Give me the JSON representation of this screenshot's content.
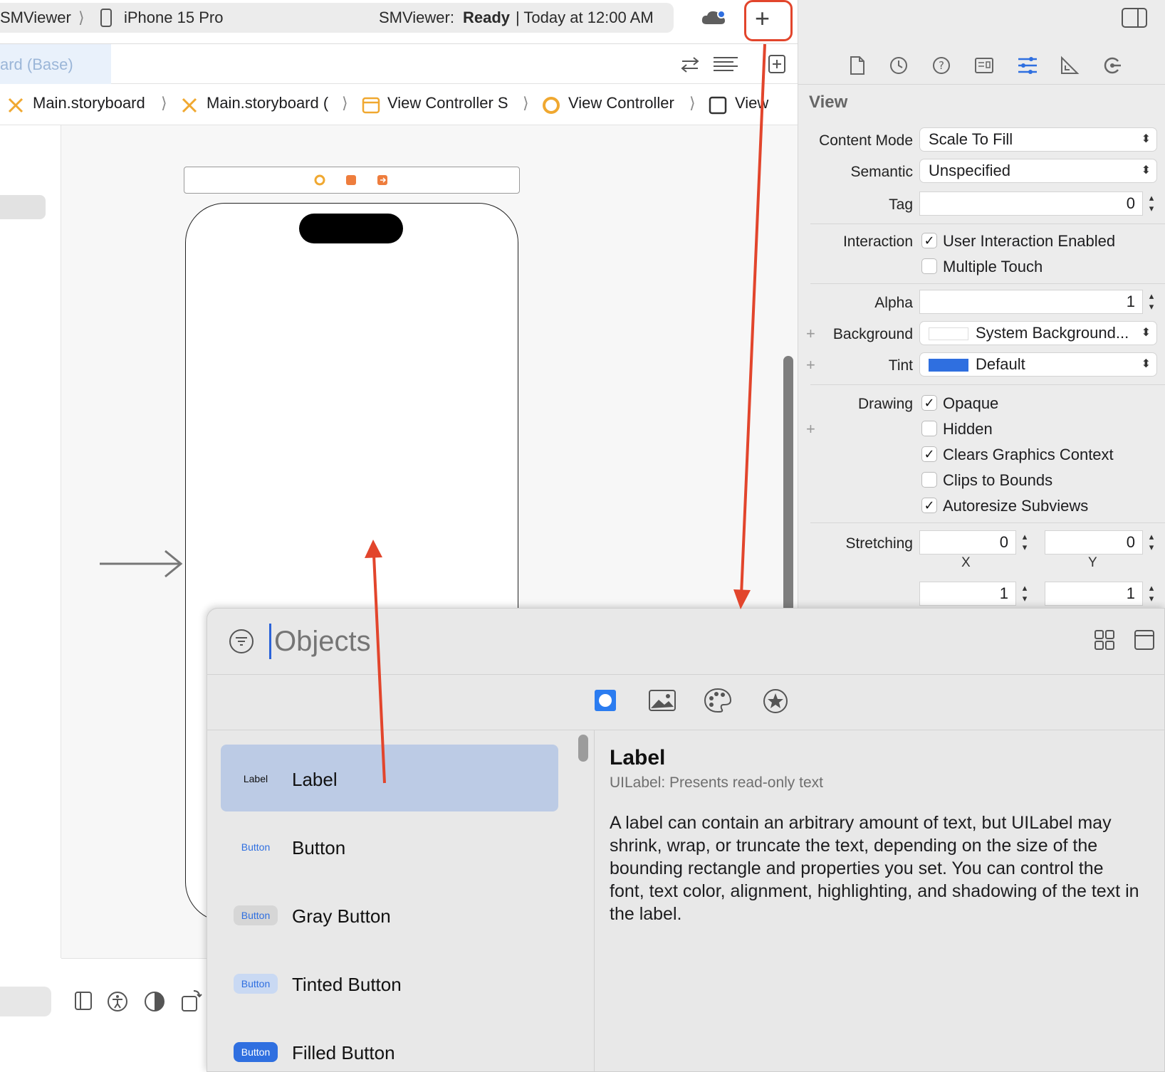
{
  "toolbar": {
    "scheme": "SMViewer",
    "device": "iPhone 15 Pro",
    "status_app": "SMViewer:",
    "status_state": "Ready",
    "status_time": "| Today at 12:00 AM",
    "add_label": "+"
  },
  "editor": {
    "tab_label": "ard (Base)",
    "breadcrumbs": [
      "Main.storyboard",
      "Main.storyboard (",
      "View Controller S",
      "View Controller",
      "View"
    ]
  },
  "inspector": {
    "section": "View",
    "content_mode_label": "Content Mode",
    "content_mode": "Scale To Fill",
    "semantic_label": "Semantic",
    "semantic": "Unspecified",
    "tag_label": "Tag",
    "tag": "0",
    "interaction_label": "Interaction",
    "user_interaction": "User Interaction Enabled",
    "multiple_touch": "Multiple Touch",
    "alpha_label": "Alpha",
    "alpha": "1",
    "background_label": "Background",
    "background": "System Background...",
    "tint_label": "Tint",
    "tint": "Default",
    "tint_color": "#2f6fe0",
    "drawing_label": "Drawing",
    "opaque": "Opaque",
    "hidden": "Hidden",
    "clears_graphics": "Clears Graphics Context",
    "clips_to_bounds": "Clips to Bounds",
    "autoresize": "Autoresize Subviews",
    "stretching_label": "Stretching",
    "stretch_x": "0",
    "stretch_y": "0",
    "x_label": "X",
    "y_label": "Y",
    "stretch_w": "1",
    "stretch_h": "1",
    "checkmark": "✓"
  },
  "library": {
    "search_placeholder": "Objects",
    "items": [
      {
        "badge": "Label",
        "title": "Label"
      },
      {
        "badge": "Button",
        "title": "Button"
      },
      {
        "badge": "Button",
        "title": "Gray Button"
      },
      {
        "badge": "Button",
        "title": "Tinted Button"
      },
      {
        "badge": "Button",
        "title": "Filled Button"
      }
    ],
    "detail_title": "Label",
    "detail_subtitle": "UILabel: Presents read-only text",
    "detail_body": "A label can contain an arbitrary amount of text, but UILabel may shrink, wrap, or truncate the text, depending on the size of the bounding rectangle and properties you set. You can control the font, text color, alignment, highlighting, and shadowing of the text in the label."
  },
  "colors": {
    "accent": "#2b63d9",
    "annotation": "#e2452c",
    "selection": "#bccbe5"
  }
}
